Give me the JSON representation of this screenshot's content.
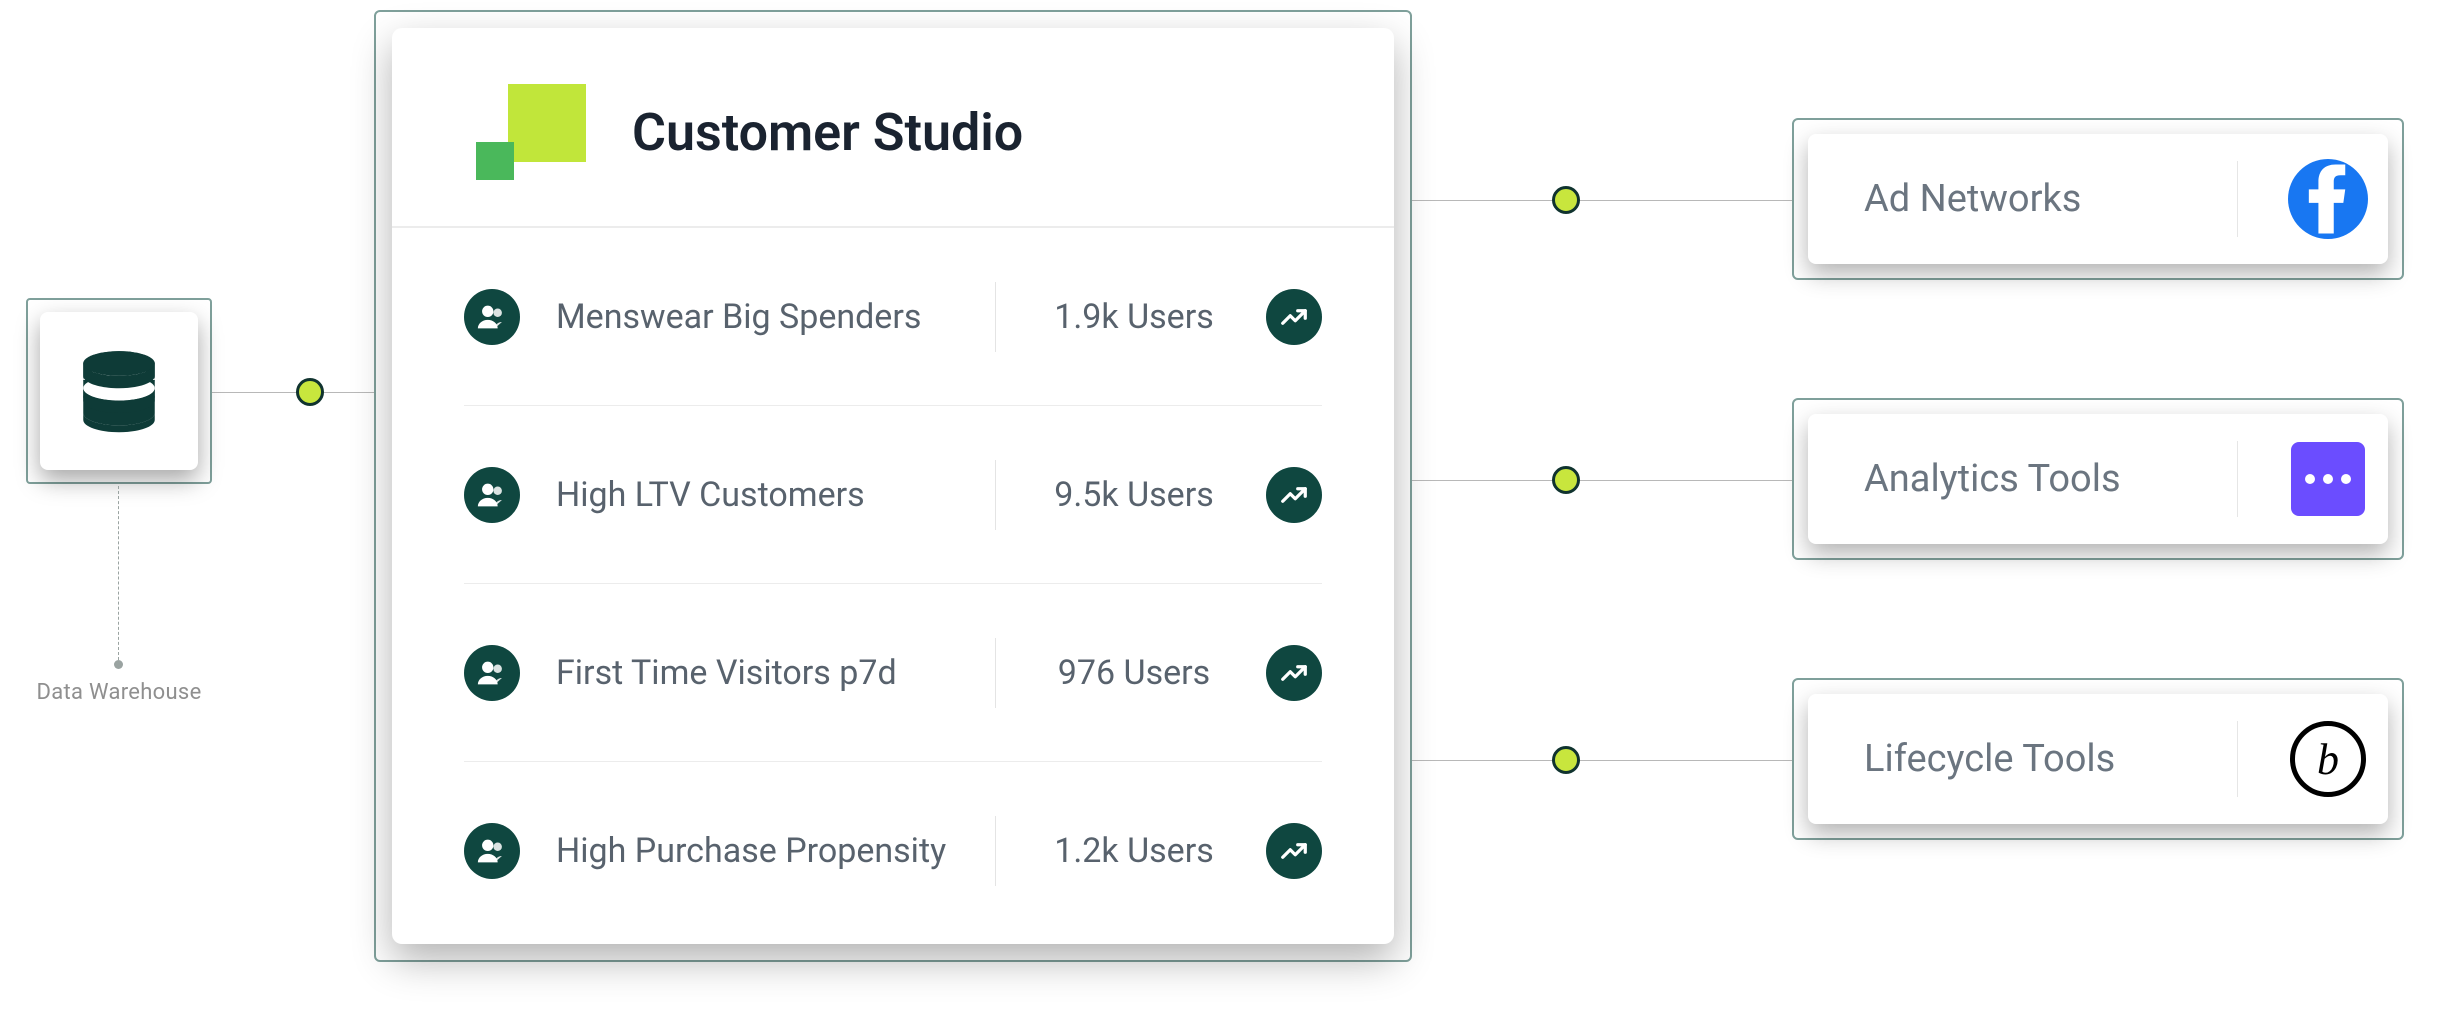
{
  "warehouse": {
    "label": "Data Warehouse"
  },
  "panel": {
    "title": "Customer Studio",
    "segments": [
      {
        "name": "Menswear Big Spenders",
        "count": "1.9k Users"
      },
      {
        "name": "High LTV Customers",
        "count": "9.5k Users"
      },
      {
        "name": "First Time Visitors p7d",
        "count": "976 Users"
      },
      {
        "name": "High Purchase Propensity",
        "count": "1.2k Users"
      }
    ]
  },
  "destinations": [
    {
      "label": "Ad Networks",
      "icon": "facebook"
    },
    {
      "label": "Analytics Tools",
      "icon": "dots"
    },
    {
      "label": "Lifecycle Tools",
      "icon": "brand-b"
    }
  ]
}
